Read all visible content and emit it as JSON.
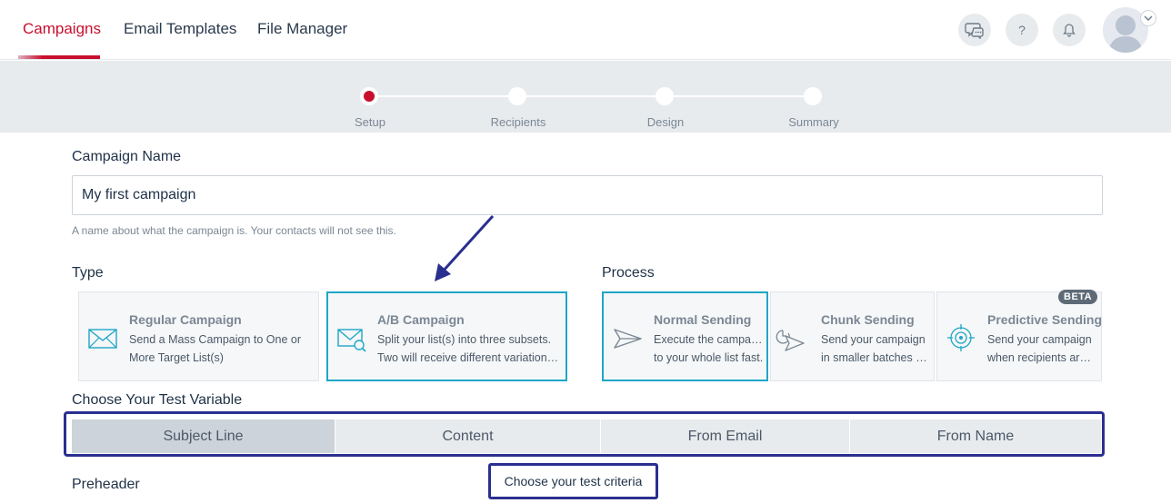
{
  "nav": {
    "tabs": [
      {
        "label": "Campaigns",
        "active": true
      },
      {
        "label": "Email Templates",
        "active": false
      },
      {
        "label": "File Manager",
        "active": false
      }
    ],
    "help_label": "?",
    "icons": [
      "chat-icon",
      "help-icon",
      "bell-icon",
      "avatar",
      "chevron-down-icon"
    ]
  },
  "stepper": {
    "steps": [
      "Setup",
      "Recipients",
      "Design",
      "Summary"
    ],
    "active_index": 0
  },
  "form": {
    "name_label": "Campaign Name",
    "name_value": "My first campaign",
    "name_hint": "A name about what the campaign is. Your contacts will not see this.",
    "type_label": "Type",
    "process_label": "Process",
    "test_variable_label": "Choose Your Test Variable",
    "preheader_label": "Preheader"
  },
  "type_cards": [
    {
      "title": "Regular Campaign",
      "desc1": "Send a Mass Campaign to One or",
      "desc2": "More Target List(s)",
      "selected": false,
      "icon": "envelope-icon"
    },
    {
      "title": "A/B Campaign",
      "desc1": "Split your list(s) into three subsets.",
      "desc2": "Two will receive different variations ...",
      "selected": true,
      "icon": "envelope-search-icon"
    }
  ],
  "process_cards": [
    {
      "title": "Normal Sending",
      "desc1": "Execute the campaign",
      "desc2": "to your whole list fast.",
      "selected": true,
      "icon": "paper-plane-icon"
    },
    {
      "title": "Chunk Sending",
      "desc1": "Send your campaign",
      "desc2": "in smaller batches t...",
      "selected": false,
      "icon": "clock-plane-icon"
    },
    {
      "title": "Predictive Sending",
      "desc1": "Send your campaign",
      "desc2": "when recipients are...",
      "selected": false,
      "icon": "target-icon",
      "badge": "BETA"
    }
  ],
  "test_variables": [
    {
      "label": "Subject Line",
      "active": true
    },
    {
      "label": "Content",
      "active": false
    },
    {
      "label": "From Email",
      "active": false
    },
    {
      "label": "From Name",
      "active": false
    }
  ],
  "annotation": {
    "tooltip": "Choose your test criteria",
    "color": "#2a2f8f"
  },
  "colors": {
    "accent": "#c8102e",
    "selected_border": "#1fa6c7"
  }
}
